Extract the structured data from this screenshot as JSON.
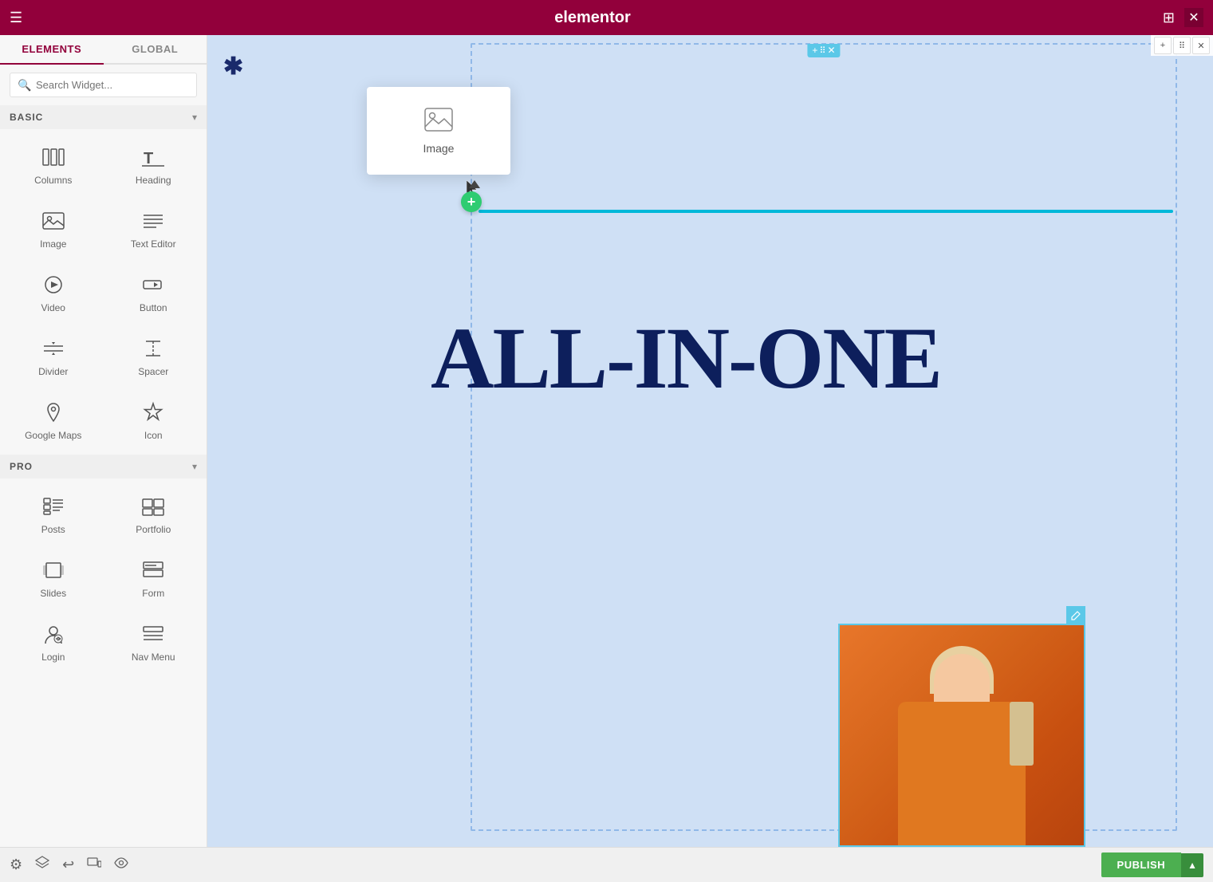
{
  "topbar": {
    "logo": "elementor",
    "hamburger": "☰",
    "grid": "⊞",
    "close": "✕"
  },
  "sidebar": {
    "tabs": [
      {
        "label": "ELEMENTS",
        "active": true
      },
      {
        "label": "GLOBAL",
        "active": false
      }
    ],
    "search_placeholder": "Search Widget...",
    "sections": [
      {
        "title": "BASIC",
        "widgets": [
          {
            "label": "Columns",
            "icon": "columns"
          },
          {
            "label": "Heading",
            "icon": "heading"
          },
          {
            "label": "Image",
            "icon": "image"
          },
          {
            "label": "Text Editor",
            "icon": "text-editor"
          },
          {
            "label": "Video",
            "icon": "video"
          },
          {
            "label": "Button",
            "icon": "button"
          },
          {
            "label": "Divider",
            "icon": "divider"
          },
          {
            "label": "Spacer",
            "icon": "spacer"
          },
          {
            "label": "Google Maps",
            "icon": "google-maps"
          },
          {
            "label": "Icon",
            "icon": "icon"
          }
        ]
      },
      {
        "title": "PRO",
        "widgets": [
          {
            "label": "Posts",
            "icon": "posts"
          },
          {
            "label": "Portfolio",
            "icon": "portfolio"
          },
          {
            "label": "Slides",
            "icon": "slides"
          },
          {
            "label": "Form",
            "icon": "form"
          },
          {
            "label": "Login",
            "icon": "login"
          },
          {
            "label": "Nav Menu",
            "icon": "nav-menu"
          }
        ]
      }
    ]
  },
  "canvas": {
    "floating_widget": {
      "label": "Image",
      "icon": "image"
    },
    "big_text": "ALL-IN-ONE",
    "section_handle": {
      "plus": "+",
      "dots": "···",
      "close": "✕"
    }
  },
  "bottombar": {
    "publish_label": "PUBLISH",
    "icons": [
      "settings",
      "layers",
      "history",
      "responsive",
      "preview"
    ]
  }
}
